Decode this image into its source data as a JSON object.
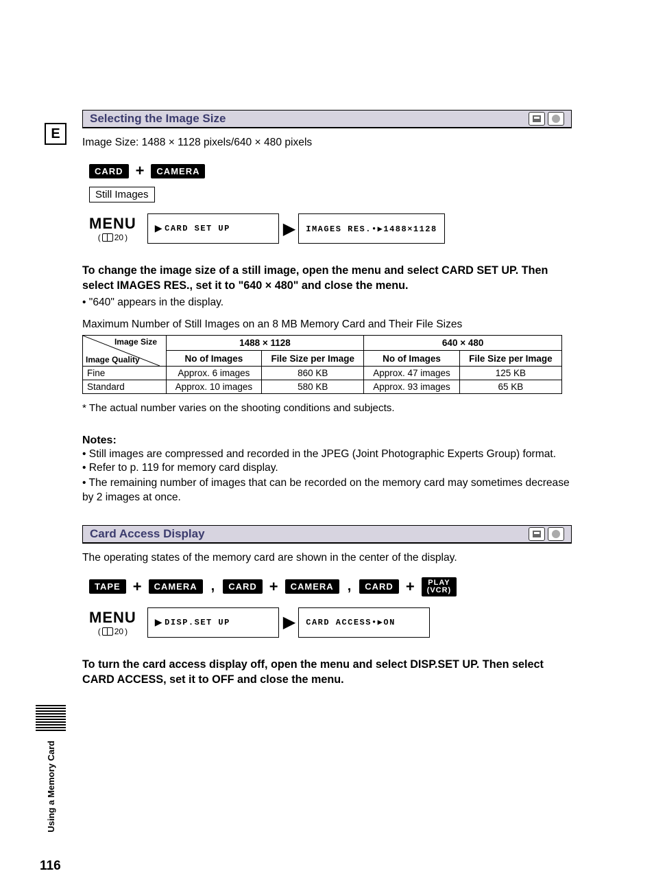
{
  "lang_badge": "E",
  "section1": {
    "title": "Selecting the Image Size",
    "image_size_text": "Image Size: 1488 × 1128 pixels/640 × 480 pixels",
    "tags": {
      "card": "CARD",
      "plus": "+",
      "camera": "CAMERA"
    },
    "mode_box": "Still Images",
    "menu": {
      "label": "MENU",
      "page_ref": "20",
      "box1_arrow": "▶",
      "box1_text": "CARD SET UP",
      "box2_text": "IMAGES RES.•▶1488×1128"
    },
    "instruction1": "To change the image size of a still image, open the menu and select CARD SET UP. Then select IMAGES RES., set it to \"640 × 480\" and close the menu.",
    "bullet1": "• \"640\" appears in the display.",
    "table_caption": "Maximum Number of Still Images on an 8 MB Memory Card and Their File Sizes",
    "table": {
      "corner_top": "Image Size",
      "corner_bottom": "Image Quality",
      "col1": "1488 × 1128",
      "col2": "640 × 480",
      "sub_a": "No of Images",
      "sub_b": "File Size per Image",
      "rows": [
        {
          "q": "Fine",
          "n1": "Approx. 6 images",
          "s1": "860 KB",
          "n2": "Approx. 47 images",
          "s2": "125 KB"
        },
        {
          "q": "Standard",
          "n1": "Approx. 10 images",
          "s1": "580 KB",
          "n2": "Approx. 93 images",
          "s2": "65 KB"
        }
      ]
    },
    "asterisk": "* The actual number varies on the shooting conditions and subjects.",
    "notes_title": "Notes:",
    "notes": [
      "• Still images are compressed and recorded in the JPEG (Joint Photographic Experts Group) format.",
      "• Refer to p. 119 for memory card display.",
      "• The remaining number of images that can be recorded on the memory card may sometimes decrease by 2 images at once."
    ]
  },
  "section2": {
    "title": "Card Access Display",
    "intro": "The operating states of the memory card are shown in the center of the display.",
    "tags": {
      "tape": "TAPE",
      "camera": "CAMERA",
      "card": "CARD",
      "play": "PLAY\n(VCR)"
    },
    "menu": {
      "label": "MENU",
      "page_ref": "20",
      "box1_text": "DISP.SET UP",
      "box2_text": "CARD ACCESS•▶ON"
    },
    "instruction": "To turn the card access display off, open the menu and select DISP.SET UP. Then select CARD ACCESS, set it to OFF and close the menu."
  },
  "sidebar_label": "Using a Memory Card",
  "page_number": "116"
}
